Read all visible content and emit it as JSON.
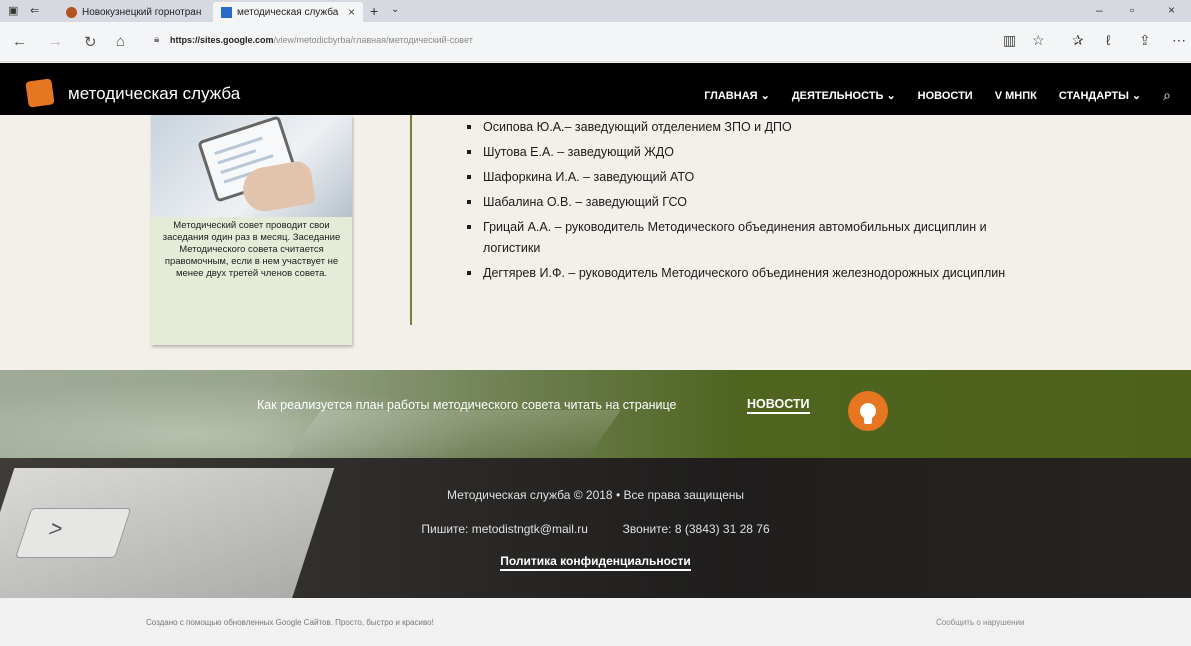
{
  "browser": {
    "tabs": [
      {
        "title": "Новокузнецкий горнотран"
      },
      {
        "title": "методическая служба"
      }
    ],
    "url_host": "https://sites.google.com",
    "url_path": "/view/metodicbyrba/главная/методический-совет"
  },
  "site": {
    "title": "методическая служба",
    "nav": [
      {
        "label": "ГЛАВНАЯ ⌄"
      },
      {
        "label": "ДЕЯТЕЛЬНОСТЬ ⌄"
      },
      {
        "label": "НОВОСТИ"
      },
      {
        "label": "V МНПК"
      },
      {
        "label": "СТАНДАРТЫ ⌄"
      }
    ],
    "accent_color": "#e57622"
  },
  "card": {
    "text": "Методический совет проводит свои заседания один раз в месяц. Заседание Методического совета считается правомочным, если в нем участвует не менее двух третей членов совета."
  },
  "members": [
    "Осипова Ю.А.– заведующий отделением ЗПО и ДПО",
    "Шутова Е.А. – заведующий ЖДО",
    "Шафоркина И.А. – заведующий АТО",
    "Шабалина О.В. – заведующий ГСО",
    "Грицай А.А. – руководитель Методического объединения автомобильных дисциплин и логистики",
    "Дегтярев И.Ф. – руководитель Методического объединения железнодорожных дисциплин"
  ],
  "banner": {
    "text": "Как реализуется план работы методического совета читать на странице",
    "link": "НОВОСТИ"
  },
  "footer": {
    "copyright": "Методическая служба © 2018 • Все права защищены",
    "write_label": "Пишите:",
    "email": "metodistngtk@mail.ru",
    "call_label": "Звоните:",
    "phone": "8 (3843) 31 28 76",
    "privacy": "Политика конфиденциальности"
  },
  "google_bar": {
    "created": "Создано с помощью обновленных Google Сайтов. Просто, быстро и красиво!",
    "report": "Сообщить о нарушении"
  }
}
